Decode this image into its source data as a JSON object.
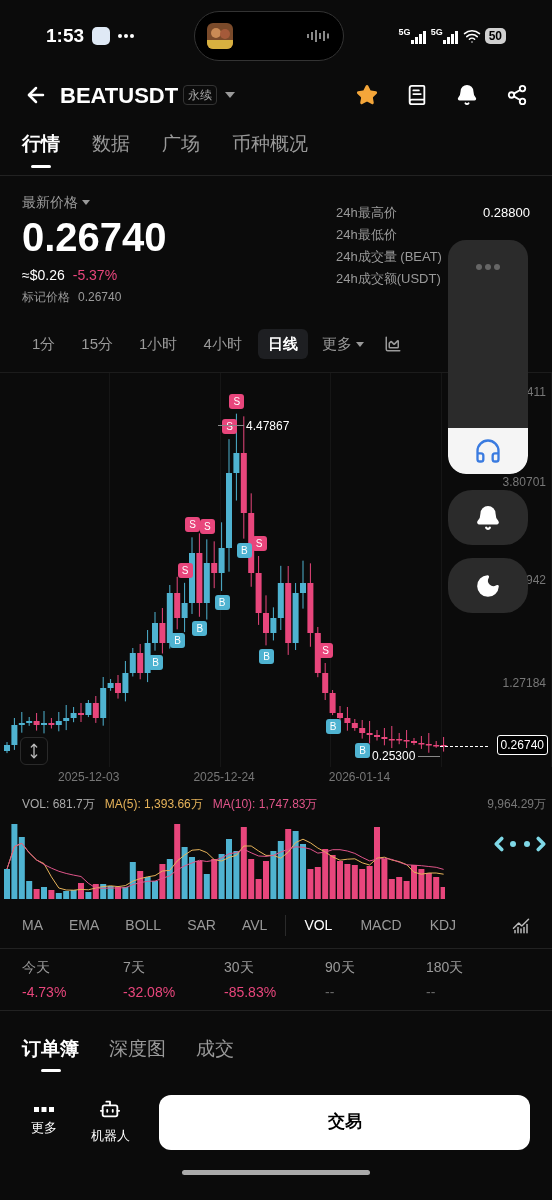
{
  "status_bar": {
    "time": "1:53",
    "networks": [
      "5G",
      "5G"
    ],
    "battery": "50"
  },
  "header": {
    "symbol": "BEATUSDT",
    "badge": "永续",
    "favorite": true
  },
  "tabs": [
    {
      "label": "行情",
      "selected": true
    },
    {
      "label": "数据",
      "selected": false
    },
    {
      "label": "广场",
      "selected": false
    },
    {
      "label": "币种概况",
      "selected": false
    }
  ],
  "price": {
    "label": "最新价格",
    "value": "0.26740",
    "usd": "≈$0.26",
    "change": "-5.37%",
    "mark_label": "标记价格",
    "mark_value": "0.26740"
  },
  "stats_24h": [
    {
      "label": "24h最高价",
      "value": "0.28800"
    },
    {
      "label": "24h最低价"
    },
    {
      "label": "24h成交量 (BEAT)"
    },
    {
      "label": "24h成交额(USDT)"
    }
  ],
  "intervals": [
    {
      "label": "1分",
      "selected": false
    },
    {
      "label": "15分",
      "selected": false
    },
    {
      "label": "1小时",
      "selected": false
    },
    {
      "label": "4小时",
      "selected": false
    },
    {
      "label": "日线",
      "selected": true
    }
  ],
  "interval_more": "更多",
  "chart": {
    "y_labels": [
      "411",
      "3.80701",
      "942",
      "1.27184"
    ],
    "high_label": "4.47867",
    "low_label": "0.25300",
    "last_price": "0.26740",
    "dates": [
      "2025-12-03",
      "2025-12-24",
      "2026-01-14"
    ],
    "markers": [
      {
        "label": "S",
        "kind": "sell"
      },
      {
        "label": "S",
        "kind": "sell"
      },
      {
        "label": "S",
        "kind": "sell"
      },
      {
        "label": "S",
        "kind": "sell"
      },
      {
        "label": "S",
        "kind": "sell"
      },
      {
        "label": "S",
        "kind": "sell"
      },
      {
        "label": "S",
        "kind": "sell"
      },
      {
        "label": "B",
        "kind": "buy"
      },
      {
        "label": "B",
        "kind": "buy"
      },
      {
        "label": "B",
        "kind": "buy"
      },
      {
        "label": "B",
        "kind": "buy"
      },
      {
        "label": "B",
        "kind": "buy"
      },
      {
        "label": "B",
        "kind": "buy"
      },
      {
        "label": "B",
        "kind": "buy"
      },
      {
        "label": "B",
        "kind": "buy"
      }
    ]
  },
  "volume": {
    "vol": "VOL: 681.7万",
    "ma5": "MA(5): 1,393.66万",
    "ma10": "MA(10): 1,747.83万",
    "max": "9,964.29万"
  },
  "main_indicators": [
    {
      "label": "MA",
      "selected": false
    },
    {
      "label": "EMA",
      "selected": false
    },
    {
      "label": "BOLL",
      "selected": false
    },
    {
      "label": "SAR",
      "selected": false
    },
    {
      "label": "AVL",
      "selected": false
    }
  ],
  "sub_indicators": [
    {
      "label": "VOL",
      "selected": true
    },
    {
      "label": "MACD",
      "selected": false
    },
    {
      "label": "KDJ",
      "selected": false
    }
  ],
  "performance": [
    {
      "label": "今天",
      "value": "-4.73%",
      "kind": "down"
    },
    {
      "label": "7天",
      "value": "-32.08%",
      "kind": "down"
    },
    {
      "label": "30天",
      "value": "-85.83%",
      "kind": "down"
    },
    {
      "label": "90天",
      "value": "--",
      "kind": "none"
    },
    {
      "label": "180天",
      "value": "--",
      "kind": "none"
    }
  ],
  "book_tabs": [
    {
      "label": "订单簿",
      "selected": true
    },
    {
      "label": "深度图",
      "selected": false
    },
    {
      "label": "成交",
      "selected": false
    }
  ],
  "bottom_bar": {
    "actions": [
      {
        "label": "更多",
        "kind": "more"
      },
      {
        "label": "机器人",
        "kind": "robot"
      }
    ],
    "trade": "交易"
  }
}
